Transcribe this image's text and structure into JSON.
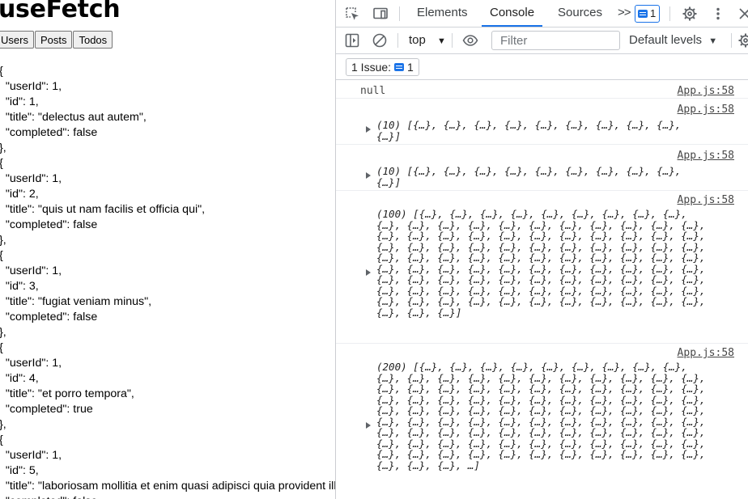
{
  "page": {
    "title": "useFetch",
    "buttons": [
      "Users",
      "Posts",
      "Todos"
    ],
    "json_text": "{\n  \"userId\": 1,\n  \"id\": 1,\n  \"title\": \"delectus aut autem\",\n  \"completed\": false\n},\n{\n  \"userId\": 1,\n  \"id\": 2,\n  \"title\": \"quis ut nam facilis et officia qui\",\n  \"completed\": false\n},\n{\n  \"userId\": 1,\n  \"id\": 3,\n  \"title\": \"fugiat veniam minus\",\n  \"completed\": false\n},\n{\n  \"userId\": 1,\n  \"id\": 4,\n  \"title\": \"et porro tempora\",\n  \"completed\": true\n},\n{\n  \"userId\": 1,\n  \"id\": 5,\n  \"title\": \"laboriosam mollitia et enim quasi adipisci quia provident illum\",\n  \"completed\": false"
  },
  "devtools": {
    "tabs": [
      "Elements",
      "Console",
      "Sources"
    ],
    "active_tab": "Console",
    "more_tabs": ">>",
    "message_count": "1",
    "context": "top",
    "filter_placeholder": "Filter",
    "levels": "Default levels",
    "issues_label": "1 Issue:",
    "issues_count": "1",
    "accent_color": "#1a73e8",
    "entries": [
      {
        "source": "App.js:58",
        "expandable": false,
        "text": "null"
      },
      {
        "source": "App.js:58",
        "expandable": true,
        "text": "(10) [{…}, {…}, {…}, {…}, {…}, {…}, {…}, {…}, {…},\n{…}]"
      },
      {
        "source": "App.js:58",
        "expandable": true,
        "text": "(10) [{…}, {…}, {…}, {…}, {…}, {…}, {…}, {…}, {…},\n{…}]"
      },
      {
        "source": "App.js:58",
        "expandable": true,
        "text": "(100) [{…}, {…}, {…}, {…}, {…}, {…}, {…}, {…}, {…},\n{…}, {…}, {…}, {…}, {…}, {…}, {…}, {…}, {…}, {…}, {…},\n{…}, {…}, {…}, {…}, {…}, {…}, {…}, {…}, {…}, {…}, {…},\n{…}, {…}, {…}, {…}, {…}, {…}, {…}, {…}, {…}, {…}, {…},\n{…}, {…}, {…}, {…}, {…}, {…}, {…}, {…}, {…}, {…}, {…},\n{…}, {…}, {…}, {…}, {…}, {…}, {…}, {…}, {…}, {…}, {…},\n{…}, {…}, {…}, {…}, {…}, {…}, {…}, {…}, {…}, {…}, {…},\n{…}, {…}, {…}, {…}, {…}, {…}, {…}, {…}, {…}, {…}, {…},\n{…}, {…}, {…}, {…}, {…}, {…}, {…}, {…}, {…}, {…}, {…},\n{…}, {…}, {…}]"
      },
      {
        "source": "App.js:58",
        "expandable": true,
        "text": "(200) [{…}, {…}, {…}, {…}, {…}, {…}, {…}, {…}, {…},\n{…}, {…}, {…}, {…}, {…}, {…}, {…}, {…}, {…}, {…}, {…},\n{…}, {…}, {…}, {…}, {…}, {…}, {…}, {…}, {…}, {…}, {…},\n{…}, {…}, {…}, {…}, {…}, {…}, {…}, {…}, {…}, {…}, {…},\n{…}, {…}, {…}, {…}, {…}, {…}, {…}, {…}, {…}, {…}, {…},\n{…}, {…}, {…}, {…}, {…}, {…}, {…}, {…}, {…}, {…}, {…},\n{…}, {…}, {…}, {…}, {…}, {…}, {…}, {…}, {…}, {…}, {…},\n{…}, {…}, {…}, {…}, {…}, {…}, {…}, {…}, {…}, {…}, {…},\n{…}, {…}, {…}, {…}, {…}, {…}, {…}, {…}, {…}, {…}, {…},\n{…}, {…}, {…}, …]"
      }
    ]
  }
}
